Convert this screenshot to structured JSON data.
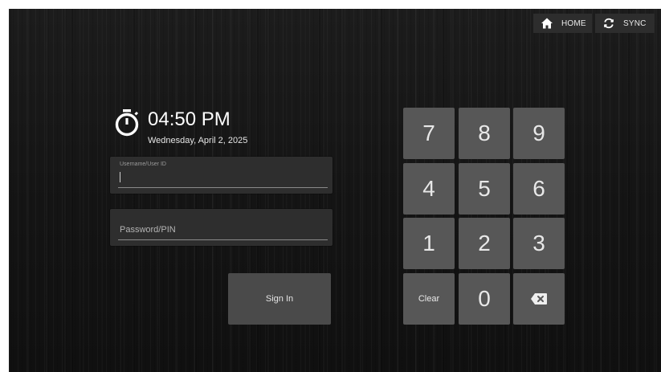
{
  "top_bar": {
    "home_label": "HOME",
    "home_icon": "home-icon",
    "sync_label": "SYNC",
    "sync_icon": "sync-icon"
  },
  "clock": {
    "icon": "stopwatch-icon",
    "time": "04:50 PM",
    "date": "Wednesday, April 2, 2025"
  },
  "login": {
    "username_label": "Username/User ID",
    "username_value": "",
    "password_placeholder": "Password/PIN",
    "password_value": "",
    "sign_in_label": "Sign In"
  },
  "keypad": {
    "keys": [
      "7",
      "8",
      "9",
      "4",
      "5",
      "6",
      "1",
      "2",
      "3",
      "Clear",
      "0",
      "backspace"
    ],
    "backspace_icon": "backspace-icon"
  },
  "colors": {
    "background": "#141414",
    "key": "#575757",
    "sign_in": "#4a4a4a",
    "field": "#2e2e2e",
    "text": "#ffffff"
  }
}
